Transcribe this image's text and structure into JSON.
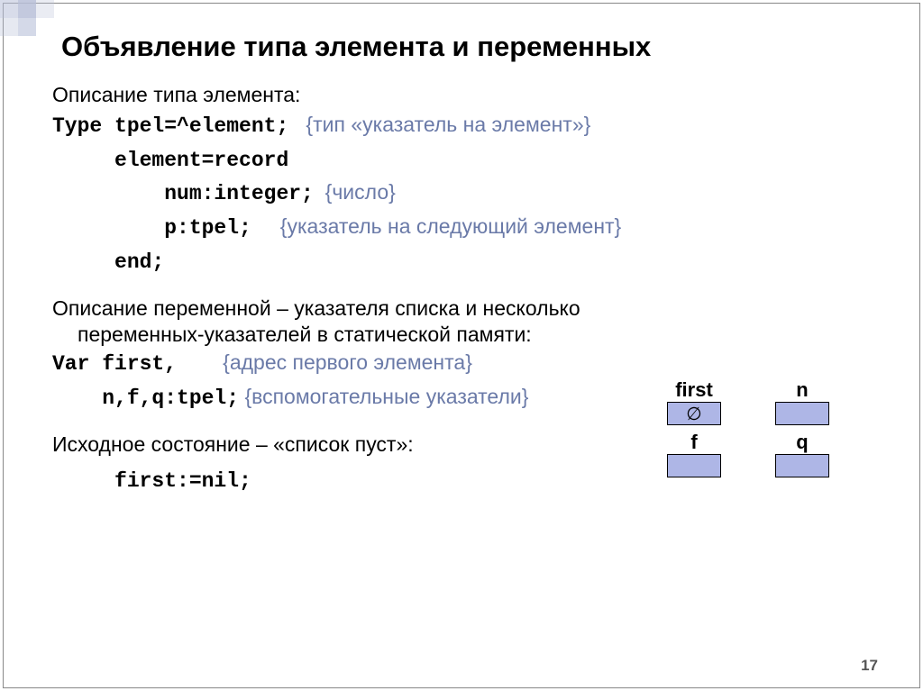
{
  "title": "Объявление типа элемента и переменных",
  "section1_heading": "Описание типа элемента:",
  "code": {
    "l1_code": "Type tpel=^element;",
    "l1_cmt": "{тип «указатель на элемент»}",
    "l2_code": "     element=record",
    "l3_code": "         num:integer;",
    "l3_cmt": "{число}",
    "l4_code": "         p:tpel;",
    "l4_cmt": "{указатель на следующий элемент}",
    "l5_code": "     end;"
  },
  "section2_line1": "Описание переменной – указателя  списка  и несколько",
  "section2_line2": "переменных-указателей в статической памяти:",
  "var": {
    "l1_code": "Var first,",
    "l1_cmt": "{адрес первого элемента}",
    "l2_code": "    n,f,q:tpel;",
    "l2_cmt": "{вспомогательные указатели}"
  },
  "section3_heading": "Исходное состояние – «список пуст»:",
  "section3_code": "     first:=nil;",
  "diagram": {
    "labels": [
      "first",
      "n",
      "f",
      "q"
    ],
    "first_symbol": "∅"
  },
  "page_number": "17"
}
